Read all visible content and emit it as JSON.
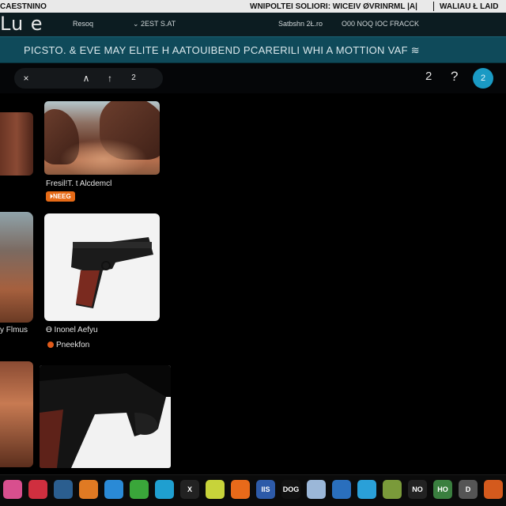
{
  "topbar": {
    "left_text": "CAESTNINO",
    "right_text": "WNIPOLTEI SOLIORI: WICEIV ØVRINRML |A|",
    "right_text_2": "WALIAU Ł LAID"
  },
  "header": {
    "logo": "Lu e",
    "link_a": "Resoq",
    "link_b": "⌄ 2EST S.AT",
    "link_c": "Satbshn 2Ł.ro",
    "link_d": "O00 NOQ IOC FRACCK"
  },
  "banner": {
    "text": "PICSTO. & EVE MAY ELITE H AATOUIBEND PCARERILI WHI A MOTTION VAF ≋"
  },
  "toolbar": {
    "close_label": "×",
    "up_label_1": "∧",
    "up_label_2": "↑",
    "number_label": "2",
    "count_label": "2",
    "help_label": "?",
    "avatar_label": "2"
  },
  "cards": {
    "c1_caption": "Fresil!T.  t Alcdemcl",
    "c1_badge": "⏵NEEG",
    "c3_caption": "y Flmus",
    "c2_caption": "Ɵ Inonel Aefyu",
    "c2_sub": "Pneekfon"
  },
  "dock": {
    "items": [
      "",
      "",
      "",
      "",
      "",
      "",
      "",
      "X",
      "",
      "",
      "IIS",
      "DOG",
      "",
      "",
      "",
      "",
      "NO",
      "HO",
      "D",
      ""
    ],
    "colors": [
      "#d84f8e",
      "#cf2f3f",
      "#2b5e8f",
      "#e07a23",
      "#2a8ad6",
      "#3aa63a",
      "#1f9fd0",
      "#222",
      "#c7d33a",
      "#e86a1a",
      "#2d5aa8",
      "#111",
      "#9bb7d8",
      "#2a6fbd",
      "#2aa0d8",
      "#7a9a3a",
      "#222",
      "#3a7f3f",
      "#555",
      "#d45a1d"
    ]
  }
}
